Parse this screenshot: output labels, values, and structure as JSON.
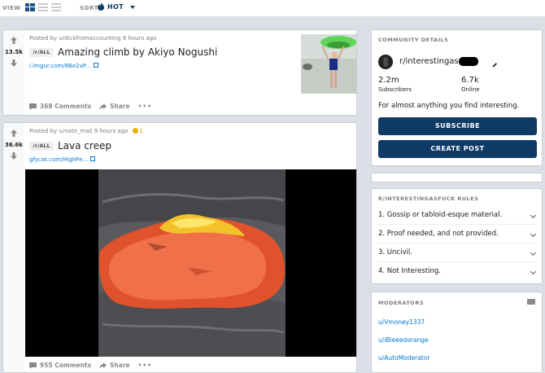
{
  "topbar": {
    "view_label": "VIEW",
    "sort_label": "SORT",
    "sort_value": "HOT"
  },
  "posts": [
    {
      "score": "13.5k",
      "meta": "Posted by u/dickfromaccounting 8 hours ago",
      "sub_tag": "/r/ALL",
      "title": "Amazing climb by Akiyo Nogushi",
      "link": "i.imgur.com/8Be2vP...",
      "comments": "368 Comments",
      "share": "Share",
      "more": "•••"
    },
    {
      "score": "36.6k",
      "meta": "Posted by u/nate_mail 9 hours ago",
      "award_count": "1",
      "sub_tag": "/r/ALL",
      "title": "Lava creep",
      "link": "gfycat.com/HighFe...",
      "comments": "955 Comments",
      "share": "Share",
      "more": "•••"
    }
  ],
  "community": {
    "header": "COMMUNITY DETAILS",
    "name": "r/interestingas",
    "subscribers_value": "2.2m",
    "subscribers_label": "Subscribers",
    "online_value": "6.7k",
    "online_label": "Online",
    "description": "For almost anything you find interesting.",
    "subscribe": "SUBSCRIBE",
    "create_post": "CREATE POST"
  },
  "rules": {
    "header": "R/INTERESTINGASFUCK RULES",
    "items": [
      "1. Gossip or tabloid-esque material.",
      "2. Proof needed, and not provided.",
      "3. Uncivil.",
      "4. Not Interesting."
    ]
  },
  "moderators": {
    "header": "MODERATORS",
    "items": [
      "u/Vmoney1337",
      "u/iBieeedorange",
      "u/AutoModerator"
    ]
  },
  "colors": {
    "accent": "#0d3b66",
    "link": "#0079d3",
    "background": "#dae0e6"
  }
}
